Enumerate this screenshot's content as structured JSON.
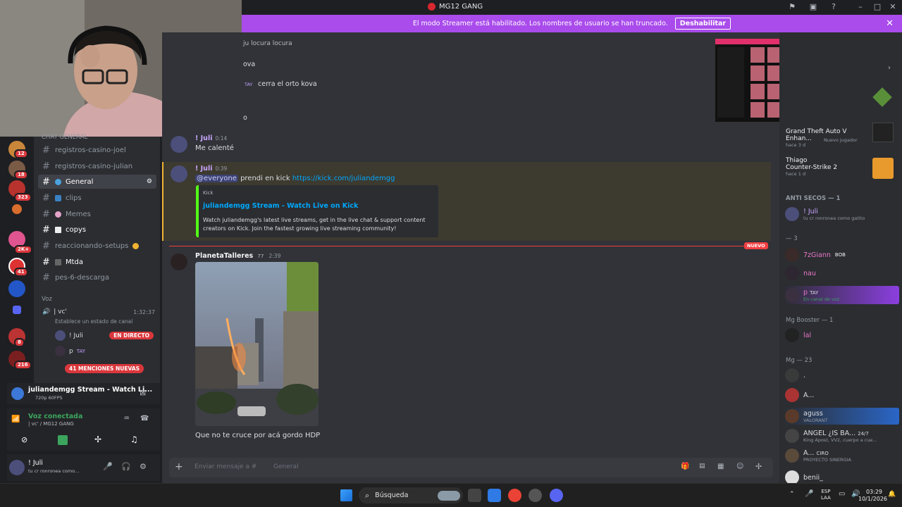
{
  "window": {
    "title": "MG12 GANG"
  },
  "banner": {
    "text": "El modo Streamer está habilitado. Los nombres de usuario se han truncado.",
    "button": "Deshabilitar"
  },
  "servers": {
    "badges": [
      "12",
      "18",
      "323",
      "2K+",
      "41",
      "8",
      "216"
    ]
  },
  "sidebar": {
    "category_chat": "CHAT GENERAL",
    "channels": [
      {
        "label": "registros-casino-joel"
      },
      {
        "label": "registros-casino-julian"
      },
      {
        "label": "General"
      },
      {
        "label": "clips"
      },
      {
        "label": "Memes"
      },
      {
        "label": "copys"
      },
      {
        "label": "reaccionando-setups"
      },
      {
        "label": "Mtda"
      },
      {
        "label": "pes-6-descarga"
      }
    ],
    "category_voice": "Voz",
    "voice_channel": {
      "name": "| vc'",
      "timer": "1:32:37",
      "status": "Establece un estado de canal"
    },
    "voice_users": [
      {
        "name": "! Juli",
        "badge": "EN DIRECTO"
      },
      {
        "name": "p",
        "tag": "TAY"
      }
    ],
    "mentions": "41 MENCIONES NUEVAS"
  },
  "stream_panel": {
    "title": "juliandemgg Stream - Watch Li...",
    "quality": "720p 60FPS"
  },
  "voice_panel": {
    "status": "Voz conectada",
    "location": "| vc' / MG12 GANG"
  },
  "user_panel": {
    "name": "! Juli",
    "status": "tu cr ronronea como..."
  },
  "chat": {
    "top_header": "ju locura locura",
    "prev_lines": [
      "ova",
      "cerra el orto kova",
      "o"
    ],
    "prev_tag": "TAY",
    "messages": [
      {
        "author": "! Juli",
        "time": "0:14",
        "text": "Me calenté"
      },
      {
        "author": "! Juli",
        "time": "0:39",
        "mention": "@everyone",
        "text": "prendi en kick",
        "link": "https://kick.com/juliandemgg"
      }
    ],
    "embed": {
      "provider": "Kick",
      "title": "juliandemgg Stream - Watch Live on Kick",
      "description": "Watch juliandemgg's latest live streams, get in the live chat & support content creators on Kick. Join the fastest growing live streaming community!"
    },
    "new_label": "NUEVO",
    "photo_message": {
      "author": "PlanetaTalleres",
      "tag": "77",
      "time": "2:39",
      "caption": "Que no te cruce por acá gordo HDP"
    },
    "composer_placeholder": "Enviar mensaje a #",
    "composer_channel": "General"
  },
  "activity": [
    {
      "title": "Grand Theft Auto V Enhan...",
      "sub": "hace 3 d",
      "extra": "Nuevo jugador"
    },
    {
      "title": "Thiago",
      "game": "Counter-Strike 2",
      "sub": "hace 1 d"
    }
  ],
  "members": {
    "groups": [
      {
        "label": "ANTI SECOS — 1",
        "items": [
          {
            "name": "! Juli",
            "sub": "tu cr ronronea como gatito"
          }
        ]
      },
      {
        "label": "— 3",
        "items": [
          {
            "name": "7zGiann",
            "tag": "BOB"
          },
          {
            "name": "nau",
            "sub": ""
          },
          {
            "name": "p",
            "tag": "TAY",
            "sub": "En canal de voz"
          }
        ]
      },
      {
        "label": "Mg Booster — 1",
        "items": [
          {
            "name": "lal"
          }
        ]
      },
      {
        "label": "Mg — 23",
        "items": [
          {
            "name": "."
          },
          {
            "name": "A..."
          },
          {
            "name": "aguss",
            "sub": "VALORANT"
          },
          {
            "name": "ANGEL ¿IS BA...",
            "tag": "24/7",
            "sub": "King Apost, VV2, cuerpo a cue..."
          },
          {
            "name": "A...",
            "tag": "CIRO",
            "sub": "PROYECTO SINERGIA"
          },
          {
            "name": "benii_"
          }
        ]
      }
    ]
  },
  "taskbar": {
    "search": "Búsqueda",
    "lang": "ESP",
    "lang2": "LAA",
    "time": "03:29",
    "date": "10/1/2026"
  },
  "colors": {
    "accent": "#5865f2",
    "streamer": "#a94ceb",
    "live": "#da373c",
    "kick": "#53fc18",
    "link": "#00a8fc"
  }
}
